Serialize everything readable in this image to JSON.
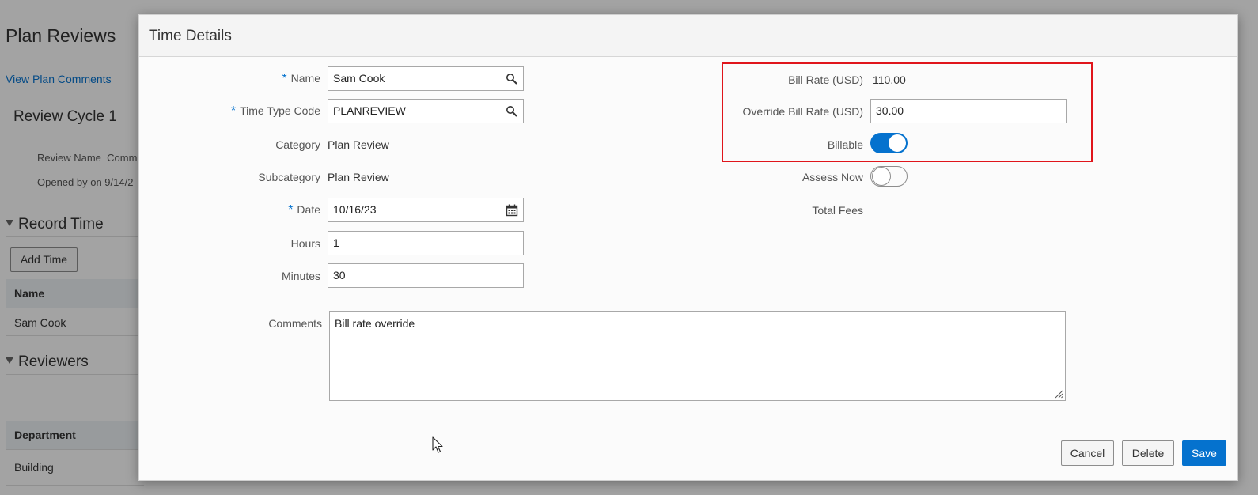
{
  "background": {
    "page_title": "Plan Reviews",
    "link_view_comments": "View Plan Comments",
    "review_cycle": "Review Cycle 1",
    "review_name_label": "Review Name",
    "review_name_value": "Comm",
    "opened_by": "Opened by on 9/14/2",
    "section_record_time": "Record Time",
    "add_time_button": "Add Time",
    "time_table_header": "Name",
    "time_table_row": "Sam Cook",
    "section_reviewers": "Reviewers",
    "reviewers_table_header": "Department",
    "reviewers_table_row": "Building"
  },
  "dialog": {
    "title": "Time Details",
    "required_mark": "*",
    "fields": {
      "name": {
        "label": "Name",
        "value": "Sam Cook"
      },
      "time_type_code": {
        "label": "Time Type Code",
        "value": "PLANREVIEW"
      },
      "category": {
        "label": "Category",
        "value": "Plan Review"
      },
      "subcategory": {
        "label": "Subcategory",
        "value": "Plan Review"
      },
      "date": {
        "label": "Date",
        "value": "10/16/23"
      },
      "hours": {
        "label": "Hours",
        "value": "1"
      },
      "minutes": {
        "label": "Minutes",
        "value": "30"
      },
      "bill_rate": {
        "label": "Bill Rate (USD)",
        "value": "110.00"
      },
      "override_bill_rate": {
        "label": "Override Bill Rate (USD)",
        "value": "30.00"
      },
      "billable": {
        "label": "Billable",
        "state": "on"
      },
      "assess_now": {
        "label": "Assess Now",
        "state": "off"
      },
      "total_fees": {
        "label": "Total Fees",
        "value": ""
      },
      "comments": {
        "label": "Comments",
        "value": "Bill rate override"
      }
    },
    "buttons": {
      "cancel": "Cancel",
      "delete": "Delete",
      "save": "Save"
    }
  },
  "colors": {
    "accent": "#0572ce",
    "highlight_border": "#e0151b"
  },
  "icons": {
    "search": "search-icon",
    "calendar": "calendar-icon",
    "resize": "resize-grip-icon",
    "cursor": "mouse-pointer-icon"
  }
}
